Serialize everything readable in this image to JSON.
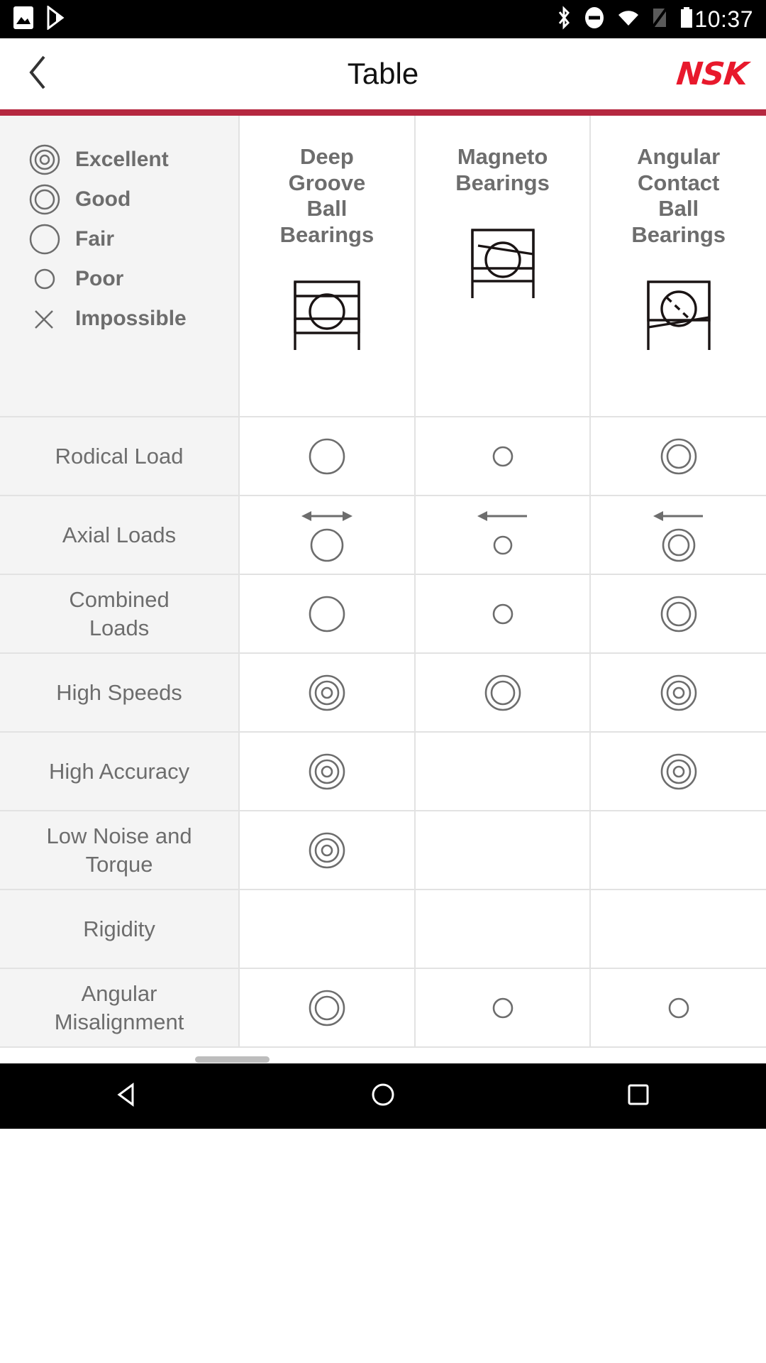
{
  "status_bar": {
    "time": "10:37",
    "left_icons": [
      "image-icon",
      "play-store-icon"
    ],
    "right_icons": [
      "bluetooth-icon",
      "do-not-disturb-icon",
      "wifi-icon",
      "no-sim-icon",
      "battery-icon"
    ]
  },
  "app_bar": {
    "back_label": "Back",
    "title": "Table",
    "brand": "NSK",
    "brand_color": "#e8192c",
    "accent_color": "#b52840"
  },
  "legend": {
    "items": [
      {
        "symbol": "excellent",
        "label": "Excellent"
      },
      {
        "symbol": "good",
        "label": "Good"
      },
      {
        "symbol": "fair",
        "label": "Fair"
      },
      {
        "symbol": "poor",
        "label": "Poor"
      },
      {
        "symbol": "impossible",
        "label": "Impossible"
      }
    ]
  },
  "table": {
    "columns": [
      {
        "name": "Deep Groove Ball Bearings",
        "lines": [
          "Deep",
          "Groove",
          "Ball",
          "Bearings"
        ],
        "icon": "deep-groove-ball-bearing-diagram"
      },
      {
        "name": "Magneto Bearings",
        "lines": [
          "Magneto",
          "Bearings"
        ],
        "icon": "magneto-bearing-diagram"
      },
      {
        "name": "Angular Contact Ball Bearings",
        "lines": [
          "Angular",
          "Contact",
          "Ball",
          "Bearings"
        ],
        "icon": "angular-contact-ball-bearing-diagram"
      }
    ],
    "rows": [
      {
        "label": "Rodical Load",
        "lines": [
          "Rodical Load"
        ],
        "cells": [
          {
            "rating": "fair"
          },
          {
            "rating": "poor"
          },
          {
            "rating": "good"
          }
        ]
      },
      {
        "label": "Axial Loads",
        "lines": [
          "Axial Loads"
        ],
        "cells": [
          {
            "rating": "fair",
            "arrow": "both"
          },
          {
            "rating": "poor",
            "arrow": "left"
          },
          {
            "rating": "good",
            "arrow": "left"
          }
        ]
      },
      {
        "label": "Combined Loads",
        "lines": [
          "Combined",
          "Loads"
        ],
        "cells": [
          {
            "rating": "fair"
          },
          {
            "rating": "poor"
          },
          {
            "rating": "good"
          }
        ]
      },
      {
        "label": "High Speeds",
        "lines": [
          "High Speeds"
        ],
        "cells": [
          {
            "rating": "excellent"
          },
          {
            "rating": "good"
          },
          {
            "rating": "excellent"
          }
        ]
      },
      {
        "label": "High Accuracy",
        "lines": [
          "High Accuracy"
        ],
        "cells": [
          {
            "rating": "excellent"
          },
          {
            "rating": "none"
          },
          {
            "rating": "excellent"
          }
        ]
      },
      {
        "label": "Low Noise and Torque",
        "lines": [
          "Low Noise and",
          "Torque"
        ],
        "cells": [
          {
            "rating": "excellent"
          },
          {
            "rating": "none"
          },
          {
            "rating": "none"
          }
        ]
      },
      {
        "label": "Rigidity",
        "lines": [
          "Rigidity"
        ],
        "cells": [
          {
            "rating": "none"
          },
          {
            "rating": "none"
          },
          {
            "rating": "none"
          }
        ]
      },
      {
        "label": "Angular Misalignment",
        "lines": [
          "Angular",
          "Misalignment"
        ],
        "cells": [
          {
            "rating": "good"
          },
          {
            "rating": "poor"
          },
          {
            "rating": "poor"
          }
        ]
      }
    ]
  },
  "nav_bar": {
    "buttons": [
      {
        "name": "back-nav-button",
        "icon": "triangle-back-icon"
      },
      {
        "name": "home-nav-button",
        "icon": "circle-home-icon"
      },
      {
        "name": "recents-nav-button",
        "icon": "square-recents-icon"
      }
    ]
  }
}
